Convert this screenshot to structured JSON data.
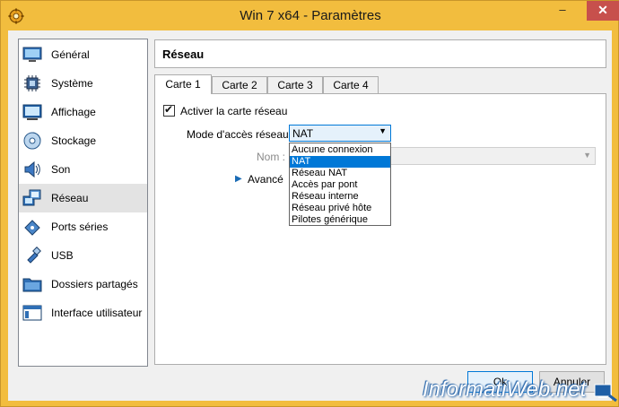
{
  "window": {
    "title": "Win 7 x64 - Paramètres",
    "min_label": "–",
    "max_label": "",
    "close_label": "✕"
  },
  "sidebar": {
    "items": [
      {
        "label": "Général",
        "icon": "monitor-icon"
      },
      {
        "label": "Système",
        "icon": "chip-icon"
      },
      {
        "label": "Affichage",
        "icon": "display-icon"
      },
      {
        "label": "Stockage",
        "icon": "disk-icon"
      },
      {
        "label": "Son",
        "icon": "speaker-icon"
      },
      {
        "label": "Réseau",
        "icon": "network-icon"
      },
      {
        "label": "Ports séries",
        "icon": "serial-port-icon"
      },
      {
        "label": "USB",
        "icon": "usb-icon"
      },
      {
        "label": "Dossiers partagés",
        "icon": "folder-icon"
      },
      {
        "label": "Interface utilisateur",
        "icon": "ui-window-icon"
      }
    ],
    "selected_index": 5
  },
  "page": {
    "title": "Réseau"
  },
  "tabs": [
    {
      "label": "Carte 1"
    },
    {
      "label": "Carte 2"
    },
    {
      "label": "Carte 3"
    },
    {
      "label": "Carte 4"
    }
  ],
  "form": {
    "enable_label": "Activer la carte réseau",
    "enable_checked": true,
    "mode_label": "Mode d'accès réseau :",
    "mode_value": "NAT",
    "name_label": "Nom :",
    "advanced_label": "Avancé"
  },
  "dropdown": {
    "options": [
      "Aucune connexion",
      "NAT",
      "Réseau NAT",
      "Accès par pont",
      "Réseau interne",
      "Réseau privé hôte",
      "Pilotes générique"
    ],
    "selected_index": 1
  },
  "buttons": {
    "ok": "Ok",
    "cancel": "Annuler"
  },
  "watermark": {
    "text": "InformatiWeb.net"
  },
  "colors": {
    "frame": "#f2bd3e",
    "accent": "#0078d7",
    "close": "#c7504c"
  }
}
